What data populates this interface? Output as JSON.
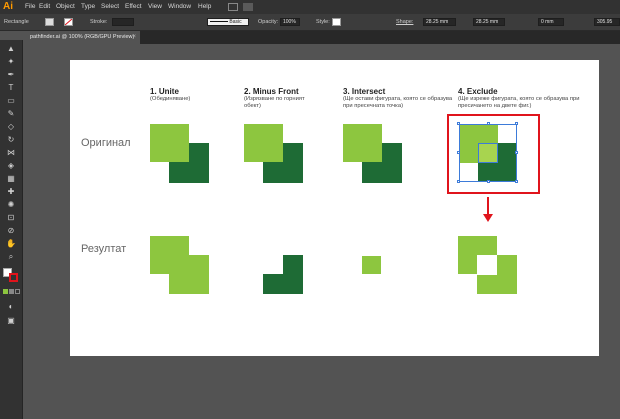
{
  "app": {
    "logo": "Ai"
  },
  "menu": [
    "File",
    "Edit",
    "Object",
    "Type",
    "Select",
    "Effect",
    "View",
    "Window",
    "Help"
  ],
  "control_bar": {
    "selection_label": "Rectangle",
    "stroke_label": "Stroke:",
    "brush_label": "Basic",
    "opacity_label": "Opacity:",
    "opacity_value": "100%",
    "style_label": "Style:",
    "shape_label": "Shape:",
    "shape_width": "28.25 mm",
    "shape_height": "28.25 mm",
    "corner_value": "0 mm",
    "x_value": "305.95"
  },
  "document_tab": {
    "title": "pathfinder.ai @ 100% (RGB/GPU Preview)",
    "close": "×"
  },
  "artboard": {
    "row_original": "Оригинал",
    "row_result": "Резултат",
    "columns": [
      {
        "title": "1. Unite",
        "subtitle": "(Обединяване)"
      },
      {
        "title": "2. Minus Front",
        "subtitle": "(Изрязване по горният обект)"
      },
      {
        "title": "3. Intersect",
        "subtitle": "(Ще остави фигурата, която се образува при пресечната точка)"
      },
      {
        "title": "4. Exclude",
        "subtitle": "(Ще изреже фигурата, която се образува при пресичането на двете фиг.)"
      }
    ]
  },
  "colors": {
    "light_green": "#8dc63f",
    "dark_green": "#1e6b35",
    "highlight": "#e0141c"
  }
}
